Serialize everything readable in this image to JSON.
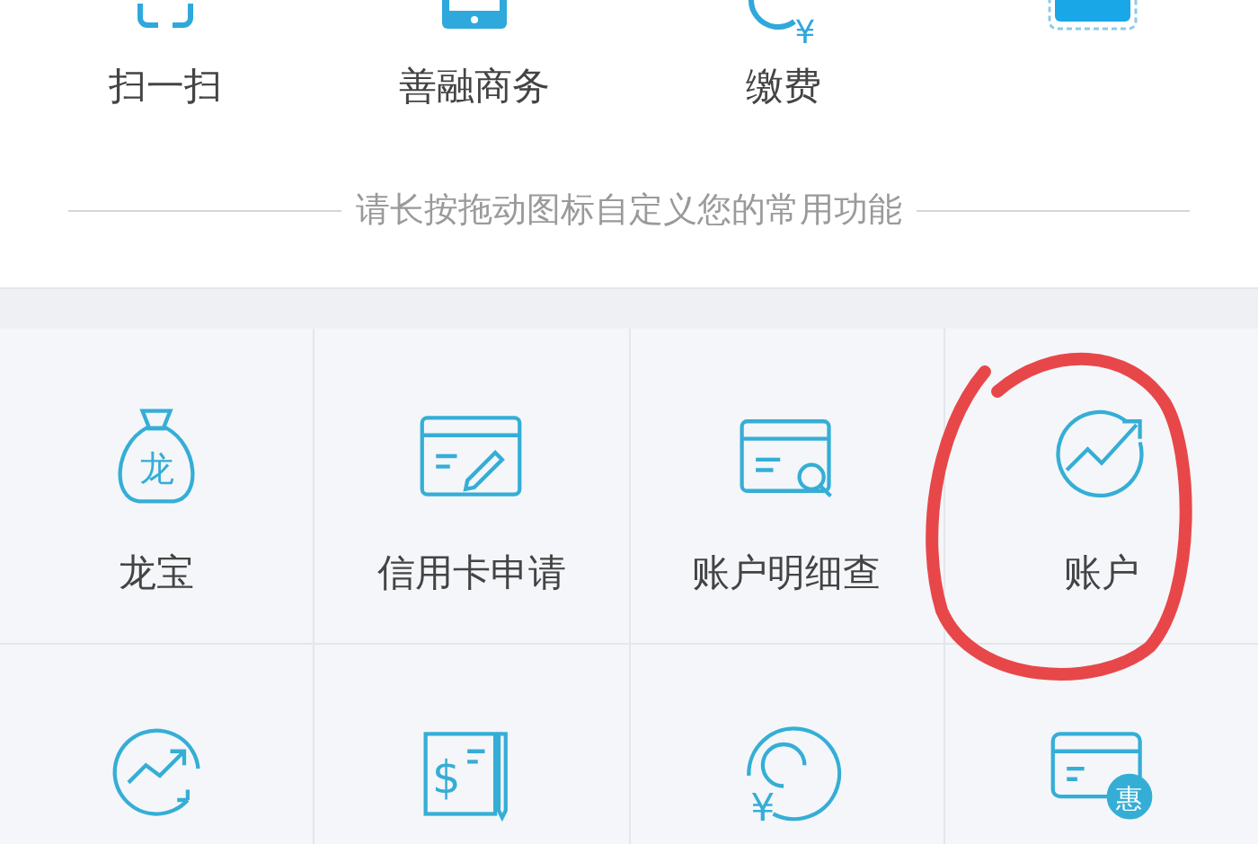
{
  "top_shortcuts": [
    {
      "label": "扫一扫",
      "kind": "scan"
    },
    {
      "label": "善融商务",
      "kind": "tablet"
    },
    {
      "label": "缴费",
      "kind": "payment",
      "glyph": "¥"
    },
    {
      "kind": "tile"
    }
  ],
  "hint": "请长按拖动图标自定义您的常用功能",
  "grid": [
    {
      "label": "龙宝",
      "kind": "bag",
      "glyph": "龙"
    },
    {
      "label": "信用卡申请",
      "kind": "card-pen"
    },
    {
      "label": "账户明细查",
      "kind": "card-search"
    },
    {
      "label": "账户",
      "kind": "trend-circle"
    },
    {
      "kind": "trend-cycle"
    },
    {
      "kind": "check-pen",
      "glyph": "$"
    },
    {
      "kind": "yen-circle",
      "glyph": "¥"
    },
    {
      "kind": "card-badge",
      "glyph": "惠"
    }
  ],
  "annotation": {
    "kind": "circle"
  }
}
